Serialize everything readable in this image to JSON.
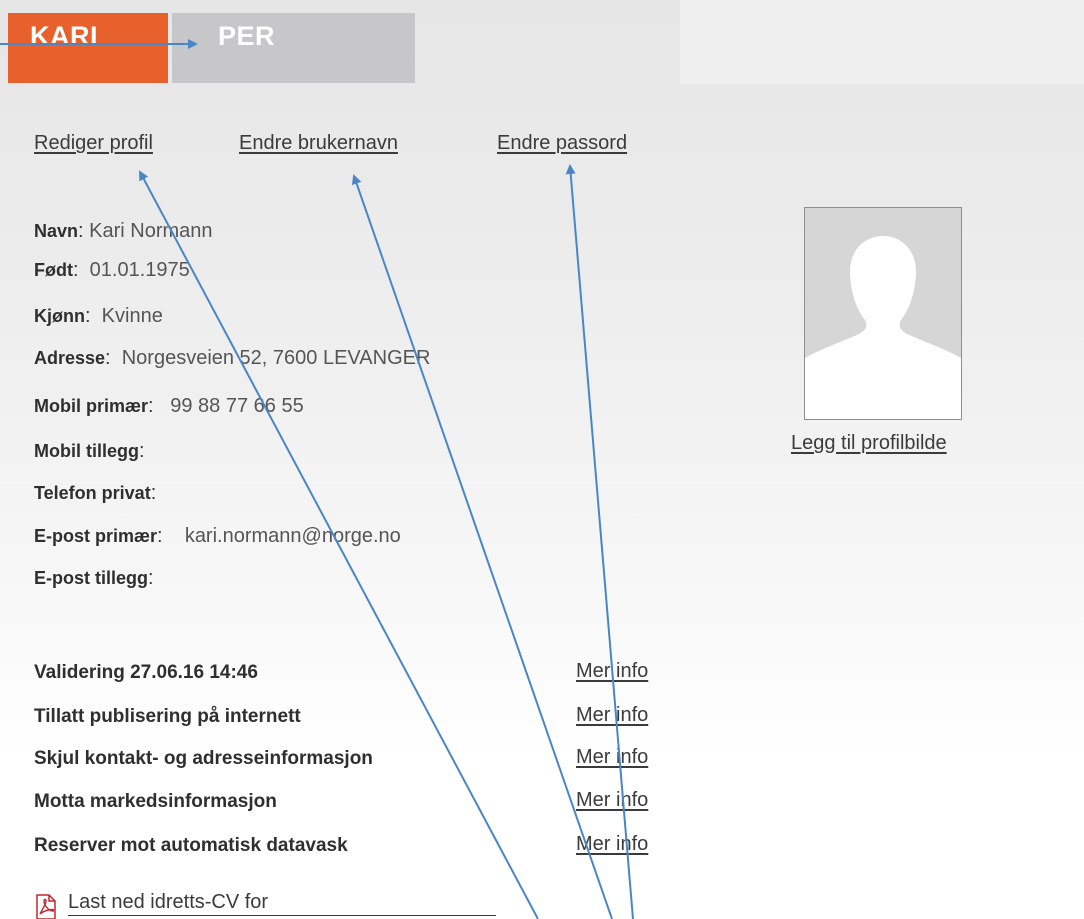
{
  "tabs": [
    {
      "label": "KARI",
      "active": true
    },
    {
      "label": "PER",
      "active": false
    }
  ],
  "actions": {
    "edit_profile": "Rediger profil",
    "change_username": "Endre brukernavn",
    "change_password": "Endre passord"
  },
  "profile": {
    "name_label": "Navn",
    "name_value": "Kari Normann",
    "born_label": "Født",
    "born_value": "01.01.1975",
    "gender_label": "Kjønn",
    "gender_value": "Kvinne",
    "address_label": "Adresse",
    "address_value": "Norgesveien 52, 7600 LEVANGER",
    "mobile_primary_label": "Mobil primær",
    "mobile_primary_value": "99 88 77 66 55",
    "mobile_extra_label": "Mobil tillegg",
    "phone_private_label": "Telefon privat",
    "email_primary_label": "E-post primær",
    "email_primary_value": "kari.normann@norge.no",
    "email_extra_label": "E-post tillegg"
  },
  "add_profile_photo": "Legg til profilbilde",
  "settings": [
    {
      "label": "Validering 27.06.16 14:46",
      "more": "Mer info"
    },
    {
      "label": "Tillatt publisering på internett",
      "more": "Mer info"
    },
    {
      "label": "Skjul kontakt- og adresseinformasjon",
      "more": "Mer info"
    },
    {
      "label": "Motta markedsinformasjon",
      "more": "Mer info"
    },
    {
      "label": "Reserver mot automatisk datavask",
      "more": "Mer info"
    }
  ],
  "download_cv": "Last ned idretts-CV for",
  "colors": {
    "active_tab": "#e8612c",
    "inactive_tab": "#c7c7c9",
    "annotation_arrow": "#4a86c5"
  },
  "icons": {
    "pdf": "pdf-icon",
    "avatar_placeholder": "person-silhouette-icon"
  }
}
